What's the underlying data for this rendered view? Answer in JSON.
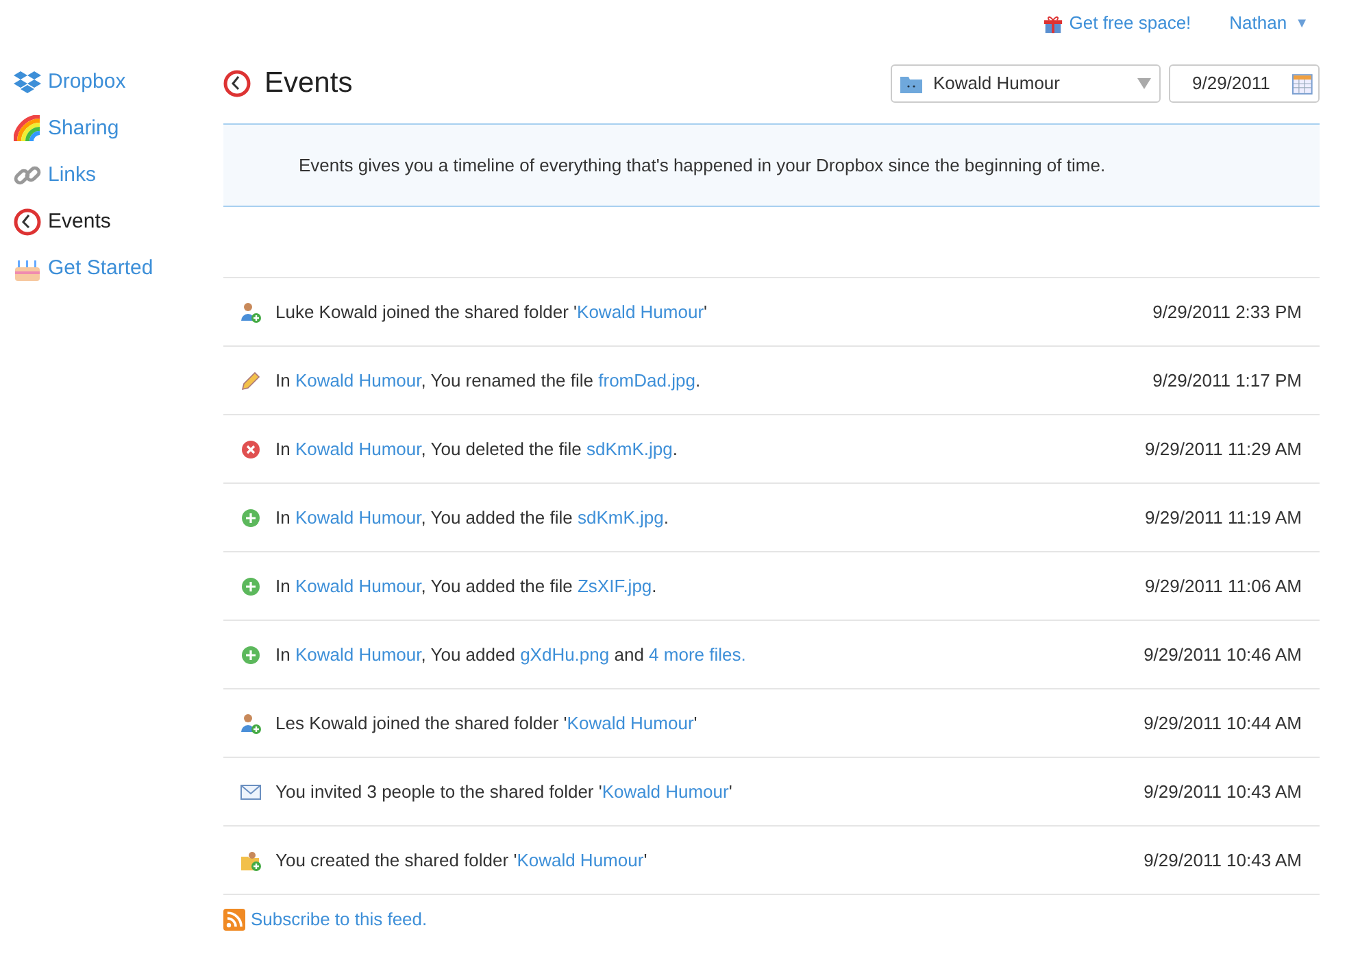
{
  "top_bar": {
    "promo": "Get free space!",
    "user": "Nathan",
    "user_caret": "▼"
  },
  "sidebar": {
    "items": [
      {
        "label": "Dropbox",
        "kind": "dropbox",
        "selected": false
      },
      {
        "label": "Sharing",
        "kind": "rainbow",
        "selected": false
      },
      {
        "label": "Links",
        "kind": "chain",
        "selected": false
      },
      {
        "label": "Events",
        "kind": "clock",
        "selected": true
      },
      {
        "label": "Get Started",
        "kind": "cake",
        "selected": false
      }
    ]
  },
  "header": {
    "title": "Events",
    "folder_select": {
      "value": "Kowald Humour"
    },
    "date_field": {
      "value": "9/29/2011"
    }
  },
  "info": "Events gives you a timeline of everything that's happened in your Dropbox since the beginning of time.",
  "events": [
    {
      "kind": "user-add",
      "parts": [
        {
          "text": "Luke Kowald joined the shared folder '",
          "link": false
        },
        {
          "text": "Kowald Humour",
          "link": true
        },
        {
          "text": "'",
          "link": false
        }
      ],
      "time": "9/29/2011 2:33 PM"
    },
    {
      "kind": "rename",
      "parts": [
        {
          "text": "In ",
          "link": false
        },
        {
          "text": "Kowald Humour",
          "link": true
        },
        {
          "text": ", You renamed the file ",
          "link": false
        },
        {
          "text": "fromDad.jpg",
          "link": true
        },
        {
          "text": ".",
          "link": false
        }
      ],
      "time": "9/29/2011 1:17 PM"
    },
    {
      "kind": "delete",
      "parts": [
        {
          "text": "In ",
          "link": false
        },
        {
          "text": "Kowald Humour",
          "link": true
        },
        {
          "text": ", You deleted the file ",
          "link": false
        },
        {
          "text": "sdKmK.jpg",
          "link": true
        },
        {
          "text": ".",
          "link": false
        }
      ],
      "time": "9/29/2011 11:29 AM"
    },
    {
      "kind": "add",
      "parts": [
        {
          "text": "In ",
          "link": false
        },
        {
          "text": "Kowald Humour",
          "link": true
        },
        {
          "text": ", You added the file ",
          "link": false
        },
        {
          "text": "sdKmK.jpg",
          "link": true
        },
        {
          "text": ".",
          "link": false
        }
      ],
      "time": "9/29/2011 11:19 AM"
    },
    {
      "kind": "add",
      "parts": [
        {
          "text": "In ",
          "link": false
        },
        {
          "text": "Kowald Humour",
          "link": true
        },
        {
          "text": ", You added the file ",
          "link": false
        },
        {
          "text": "ZsXIF.jpg",
          "link": true
        },
        {
          "text": ".",
          "link": false
        }
      ],
      "time": "9/29/2011 11:06 AM"
    },
    {
      "kind": "add",
      "parts": [
        {
          "text": "In ",
          "link": false
        },
        {
          "text": "Kowald Humour",
          "link": true
        },
        {
          "text": ", You added ",
          "link": false
        },
        {
          "text": "gXdHu.png",
          "link": true
        },
        {
          "text": " and ",
          "link": false
        },
        {
          "text": "4 more files.",
          "link": true
        }
      ],
      "time": "9/29/2011 10:46 AM"
    },
    {
      "kind": "user-add",
      "parts": [
        {
          "text": "Les Kowald joined the shared folder '",
          "link": false
        },
        {
          "text": "Kowald Humour",
          "link": true
        },
        {
          "text": "'",
          "link": false
        }
      ],
      "time": "9/29/2011 10:44 AM"
    },
    {
      "kind": "invite",
      "parts": [
        {
          "text": "You invited 3 people to the shared folder '",
          "link": false
        },
        {
          "text": "Kowald Humour",
          "link": true
        },
        {
          "text": "'",
          "link": false
        }
      ],
      "time": "9/29/2011 10:43 AM"
    },
    {
      "kind": "share-folder",
      "parts": [
        {
          "text": "You created the shared folder '",
          "link": false
        },
        {
          "text": "Kowald Humour",
          "link": true
        },
        {
          "text": "'",
          "link": false
        }
      ],
      "time": "9/29/2011 10:43 AM"
    }
  ],
  "feed_link": "Subscribe to this feed."
}
